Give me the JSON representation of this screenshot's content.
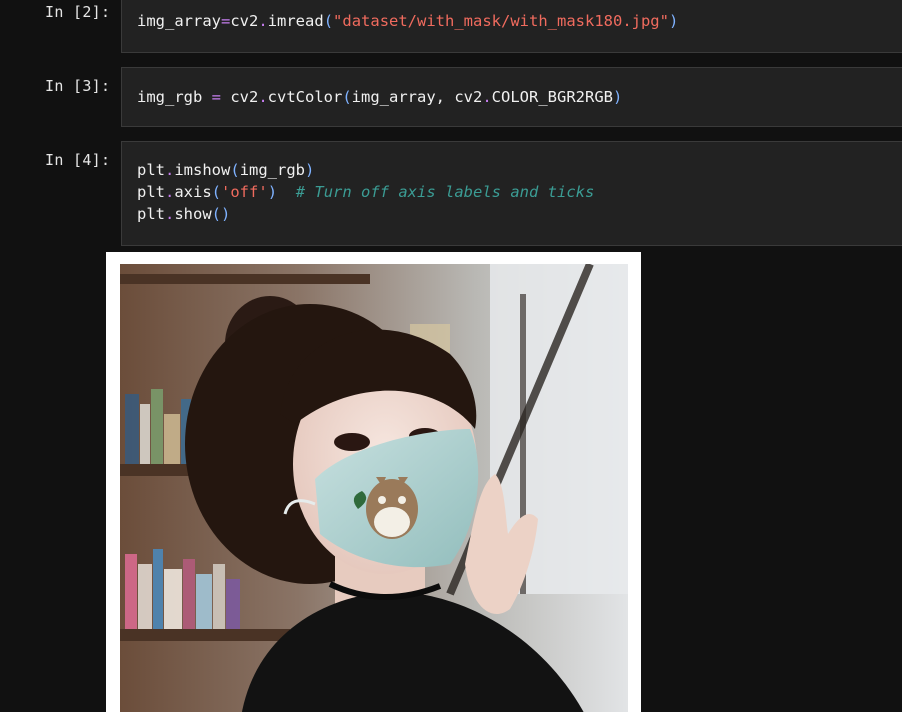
{
  "cells": [
    {
      "prompt": "In [2]:",
      "lines": [
        {
          "tokens": [
            {
              "t": "img_array",
              "c": "var"
            },
            {
              "t": "=",
              "c": "op"
            },
            {
              "t": "cv2",
              "c": "var"
            },
            {
              "t": ".",
              "c": "op"
            },
            {
              "t": "imread",
              "c": "var"
            },
            {
              "t": "(",
              "c": "paren"
            },
            {
              "t": "\"dataset/with_mask/with_mask180.jpg\"",
              "c": "str"
            },
            {
              "t": ")",
              "c": "paren"
            }
          ]
        }
      ]
    },
    {
      "prompt": "In [3]:",
      "lines": [
        {
          "tokens": [
            {
              "t": "img_rgb ",
              "c": "var"
            },
            {
              "t": "=",
              "c": "op"
            },
            {
              "t": " cv2",
              "c": "var"
            },
            {
              "t": ".",
              "c": "op"
            },
            {
              "t": "cvtColor",
              "c": "var"
            },
            {
              "t": "(",
              "c": "paren"
            },
            {
              "t": "img_array, cv2",
              "c": "var"
            },
            {
              "t": ".",
              "c": "op"
            },
            {
              "t": "COLOR_BGR2RGB",
              "c": "var"
            },
            {
              "t": ")",
              "c": "paren"
            }
          ]
        }
      ]
    },
    {
      "prompt": "In [4]:",
      "lines": [
        {
          "tokens": [
            {
              "t": "plt",
              "c": "var"
            },
            {
              "t": ".",
              "c": "op"
            },
            {
              "t": "imshow",
              "c": "var"
            },
            {
              "t": "(",
              "c": "paren"
            },
            {
              "t": "img_rgb",
              "c": "var"
            },
            {
              "t": ")",
              "c": "paren"
            }
          ]
        },
        {
          "tokens": [
            {
              "t": "plt",
              "c": "var"
            },
            {
              "t": ".",
              "c": "op"
            },
            {
              "t": "axis",
              "c": "var"
            },
            {
              "t": "(",
              "c": "paren"
            },
            {
              "t": "'off'",
              "c": "str"
            },
            {
              "t": ")",
              "c": "paren"
            },
            {
              "t": "  ",
              "c": "var"
            },
            {
              "t": "# Turn off axis labels and ticks",
              "c": "comment"
            }
          ]
        },
        {
          "tokens": [
            {
              "t": "plt",
              "c": "var"
            },
            {
              "t": ".",
              "c": "op"
            },
            {
              "t": "show",
              "c": "var"
            },
            {
              "t": "(",
              "c": "paren"
            },
            {
              "t": ")",
              "c": "paren"
            }
          ]
        }
      ]
    }
  ],
  "output": {
    "image_icon": "photo-of-woman-wearing-face-mask"
  },
  "colors": {
    "background": "#111111",
    "cell_background": "#222222",
    "operator": "#c67ef0",
    "string": "#f06b5e",
    "paren": "#7fb2ff",
    "comment": "#3b9c94"
  }
}
